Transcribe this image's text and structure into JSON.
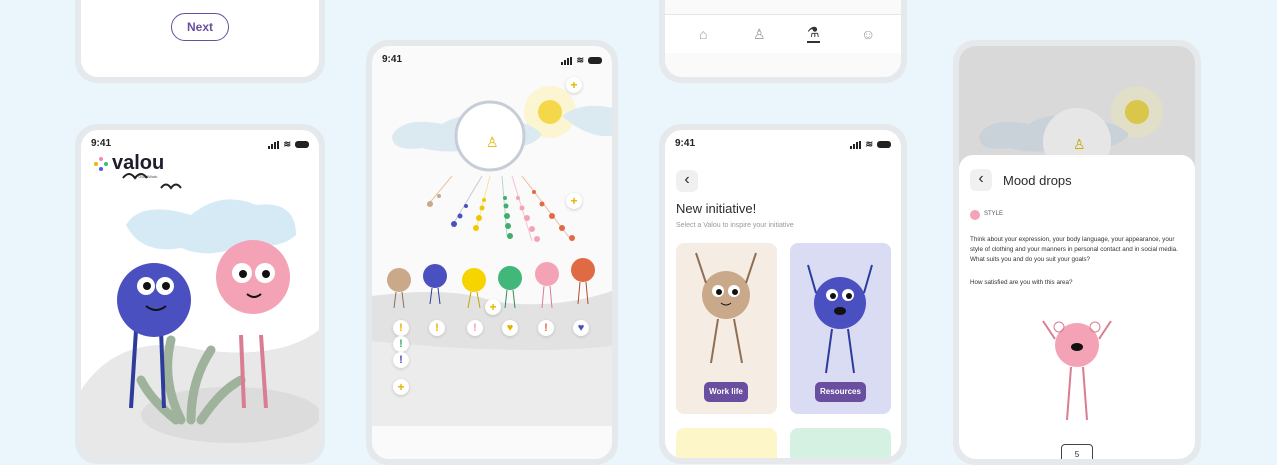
{
  "status_time": "9:41",
  "colors": {
    "background": "#eaf6fc",
    "accent": "#6a4ea0",
    "sun": "#f5d84a"
  },
  "phone1": {
    "next_button": "Next"
  },
  "phone2": {
    "logo_text": "valou",
    "logo_sub": "by GoodWork"
  },
  "phone3": {
    "plus_symbol": "+",
    "marks": [
      "!",
      "!",
      "!",
      "♥",
      "!",
      "♥"
    ],
    "character_names": [
      "tan-character",
      "blue-character",
      "yellow-character",
      "green-character",
      "pink-character",
      "red-character"
    ]
  },
  "phone4": {
    "nav_items": [
      "home-icon",
      "profile-icon",
      "initiatives-icon",
      "mood-icon"
    ]
  },
  "phone5": {
    "back_label": "‹",
    "title": "New initiative!",
    "subtitle": "Select a Valou to inspire your initiative",
    "cards": [
      {
        "label": "Work life"
      },
      {
        "label": "Resources"
      }
    ]
  },
  "phone6": {
    "back_label": "‹",
    "title": "Mood drops",
    "tag": "STYLE",
    "body": "Think about your expression, your body language, your appearance, your style of clothing and your manners in personal contact and in social media. What suits you and do you suit your goals?",
    "question": "How satisfied are you with this area?",
    "score": "5"
  }
}
